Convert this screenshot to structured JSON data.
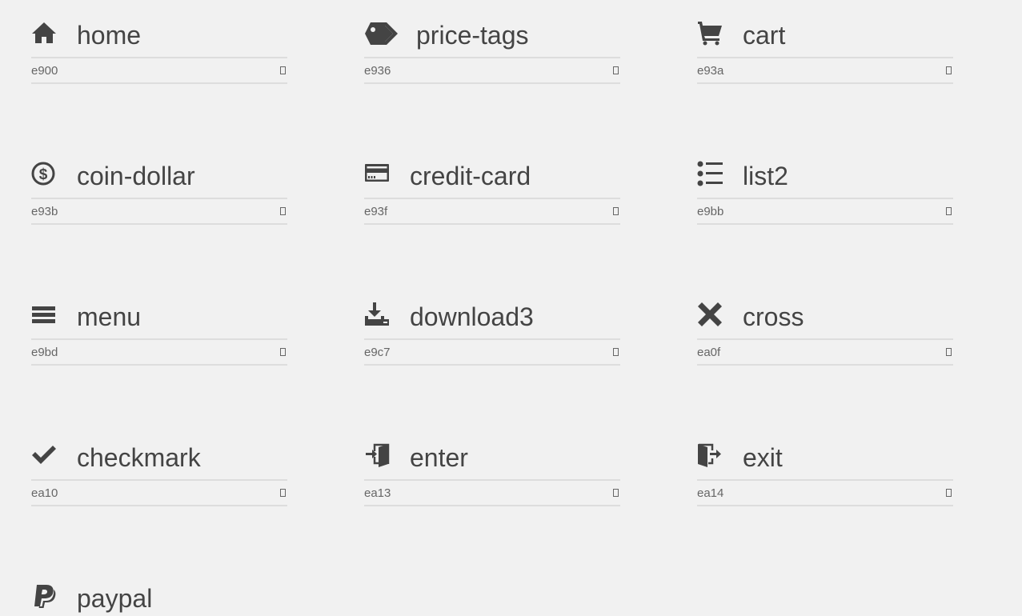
{
  "glyphs": [
    {
      "name": "home",
      "code": "e900",
      "icon": "home-icon"
    },
    {
      "name": "price-tags",
      "code": "e936",
      "icon": "price-tags-icon"
    },
    {
      "name": "cart",
      "code": "e93a",
      "icon": "cart-icon"
    },
    {
      "name": "coin-dollar",
      "code": "e93b",
      "icon": "coin-dollar-icon"
    },
    {
      "name": "credit-card",
      "code": "e93f",
      "icon": "credit-card-icon"
    },
    {
      "name": "list2",
      "code": "e9bb",
      "icon": "list2-icon"
    },
    {
      "name": "menu",
      "code": "e9bd",
      "icon": "menu-icon"
    },
    {
      "name": "download3",
      "code": "e9c7",
      "icon": "download3-icon"
    },
    {
      "name": "cross",
      "code": "ea0f",
      "icon": "cross-icon"
    },
    {
      "name": "checkmark",
      "code": "ea10",
      "icon": "checkmark-icon"
    },
    {
      "name": "enter",
      "code": "ea13",
      "icon": "enter-icon"
    },
    {
      "name": "exit",
      "code": "ea14",
      "icon": "exit-icon"
    },
    {
      "name": "paypal",
      "code": "",
      "icon": "paypal-icon"
    }
  ],
  "colors": {
    "background": "#f1f1f1",
    "text": "#444444",
    "code_text": "#666666",
    "divider": "#dddddd"
  }
}
